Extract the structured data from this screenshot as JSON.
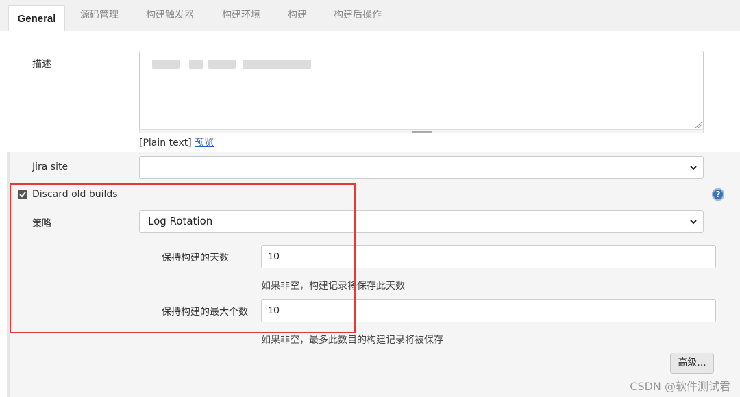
{
  "tabs": [
    {
      "label": "General",
      "active": true
    },
    {
      "label": "源码管理"
    },
    {
      "label": "构建触发器"
    },
    {
      "label": "构建环境"
    },
    {
      "label": "构建"
    },
    {
      "label": "构建后操作"
    }
  ],
  "description": {
    "label": "描述",
    "value": "",
    "note_text": "[Plain text]",
    "preview_link": "预览"
  },
  "jira": {
    "label": "Jira site",
    "selected": ""
  },
  "discard": {
    "checkbox_label": "Discard old builds",
    "checked": true,
    "strategy_label": "策略",
    "strategy_selected": "Log Rotation",
    "days_label": "保持构建的天数",
    "days_value": "10",
    "days_hint": "如果非空，构建记录将保存此天数",
    "max_label": "保持构建的最大个数",
    "max_value": "10",
    "max_hint": "如果非空，最多此数目的构建记录将被保存",
    "advanced_button": "高级..."
  },
  "help_icon": "?",
  "watermark": "CSDN @软件测试君",
  "colors": {
    "highlight": "#e53935",
    "link": "#2a60b8",
    "help": "#3b73b9"
  }
}
